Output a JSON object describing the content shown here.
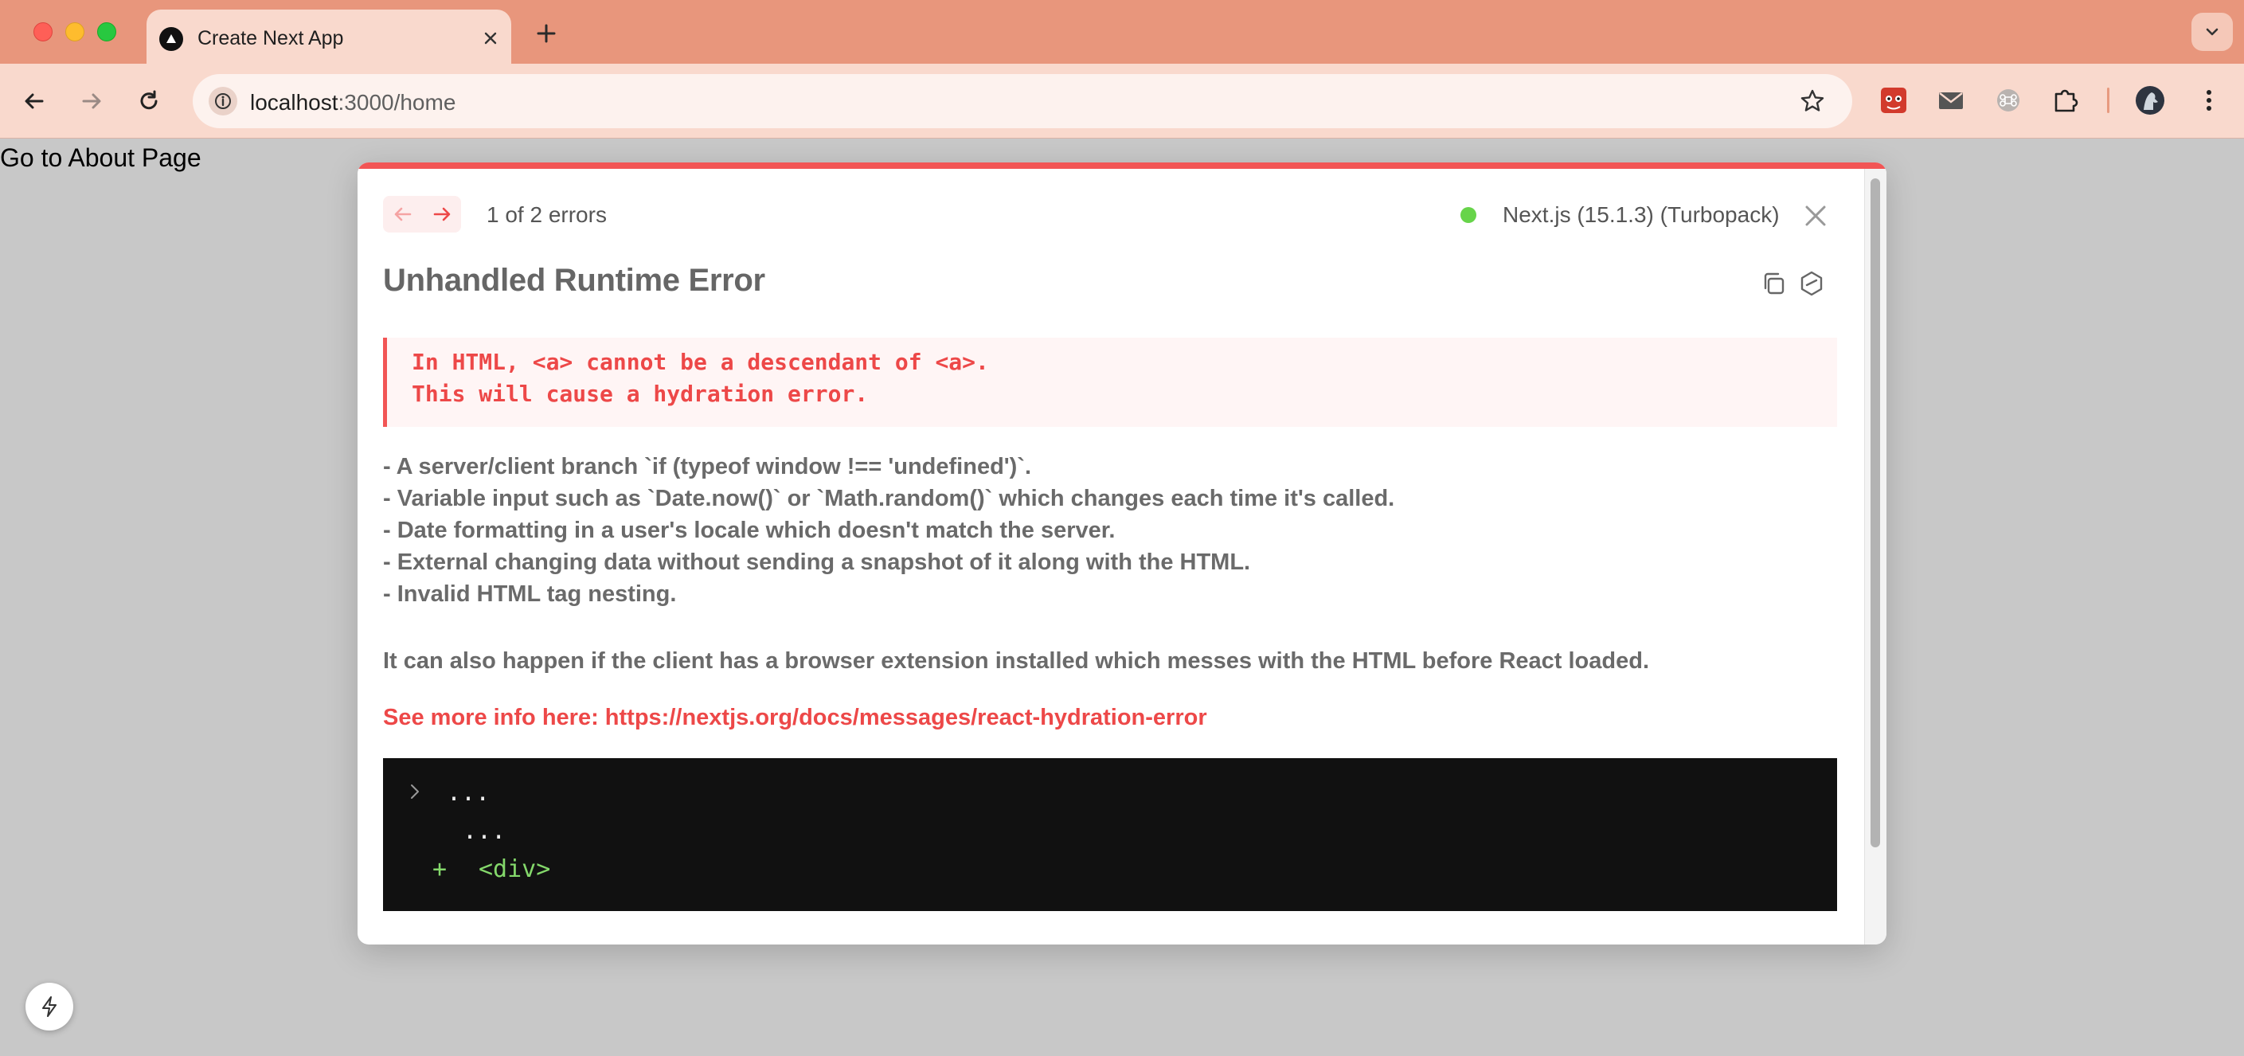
{
  "browser": {
    "tab_title": "Create Next App",
    "url_host": "localhost",
    "url_rest": ":3000/home",
    "icons": [
      "close-icon",
      "plus-icon",
      "chevron-down-icon",
      "back-arrow-icon",
      "forward-arrow-icon",
      "reload-icon",
      "site-info-icon",
      "star-icon",
      "extension-icon",
      "profile-avatar",
      "more-vert-icon"
    ]
  },
  "page": {
    "link_text": "Go to About Page"
  },
  "overlay": {
    "error_count": "1 of 2 errors",
    "version": "Next.js (15.1.3) (Turbopack)",
    "title": "Unhandled Runtime Error",
    "message_lines": [
      "In HTML, <a> cannot be a descendant of <a>.",
      "This will cause a hydration error."
    ],
    "bullets": [
      "- A server/client branch `if (typeof window !== 'undefined')`.",
      "- Variable input such as `Date.now()` or `Math.random()` which changes each time it's called.",
      "- Date formatting in a user's locale which doesn't match the server.",
      "- External changing data without sending a snapshot of it along with the HTML.",
      "- Invalid HTML tag nesting."
    ],
    "also_text": "It can also happen if the client has a browser extension installed which messes with the HTML before React loaded.",
    "see_more": "See more info here: https://nextjs.org/docs/messages/react-hydration-error",
    "code": {
      "line1": "...",
      "line2": "...",
      "plus": "+",
      "line3": "<div>"
    },
    "colors": {
      "accent": "#f25555",
      "status_ok": "#67d44a",
      "code_bg": "#111111",
      "diff_added": "#84d86b"
    }
  }
}
